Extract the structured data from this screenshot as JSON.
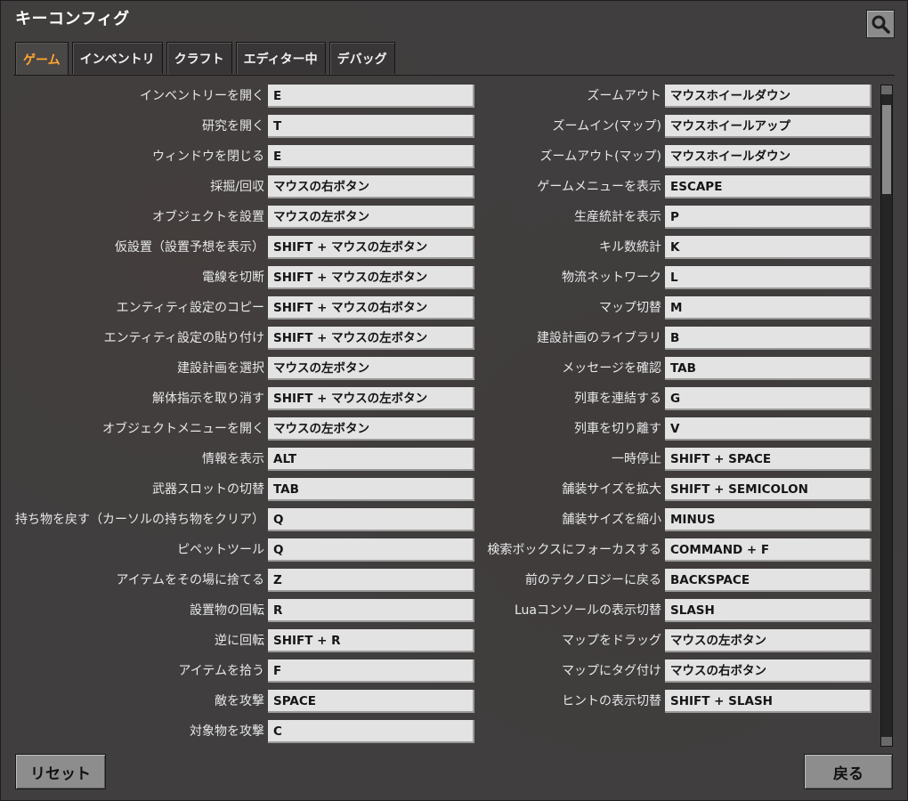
{
  "window": {
    "title": "キーコンフィグ"
  },
  "tabs": [
    {
      "label": "ゲーム",
      "active": true
    },
    {
      "label": "インベントリ",
      "active": false
    },
    {
      "label": "クラフト",
      "active": false
    },
    {
      "label": "エディター中",
      "active": false
    },
    {
      "label": "デバッグ",
      "active": false
    }
  ],
  "left_bindings": [
    {
      "action": "インベントリーを開く",
      "key": "E"
    },
    {
      "action": "研究を開く",
      "key": "T"
    },
    {
      "action": "ウィンドウを閉じる",
      "key": "E"
    },
    {
      "action": "採掘/回収",
      "key": "マウスの右ボタン"
    },
    {
      "action": "オブジェクトを設置",
      "key": "マウスの左ボタン"
    },
    {
      "action": "仮設置（設置予想を表示）",
      "key": "SHIFT + マウスの左ボタン"
    },
    {
      "action": "電線を切断",
      "key": "SHIFT + マウスの左ボタン"
    },
    {
      "action": "エンティティ設定のコピー",
      "key": "SHIFT + マウスの右ボタン"
    },
    {
      "action": "エンティティ設定の貼り付け",
      "key": "SHIFT + マウスの左ボタン"
    },
    {
      "action": "建設計画を選択",
      "key": "マウスの左ボタン"
    },
    {
      "action": "解体指示を取り消す",
      "key": "SHIFT + マウスの左ボタン"
    },
    {
      "action": "オブジェクトメニューを開く",
      "key": "マウスの左ボタン"
    },
    {
      "action": "情報を表示",
      "key": "ALT"
    },
    {
      "action": "武器スロットの切替",
      "key": "TAB"
    },
    {
      "action": "持ち物を戻す（カーソルの持ち物をクリア）",
      "key": "Q"
    },
    {
      "action": "ピペットツール",
      "key": "Q"
    },
    {
      "action": "アイテムをその場に捨てる",
      "key": "Z"
    },
    {
      "action": "設置物の回転",
      "key": "R"
    },
    {
      "action": "逆に回転",
      "key": "SHIFT + R"
    },
    {
      "action": "アイテムを拾う",
      "key": "F"
    },
    {
      "action": "敵を攻撃",
      "key": "SPACE"
    },
    {
      "action": "対象物を攻撃",
      "key": "C"
    }
  ],
  "right_bindings": [
    {
      "action": "ズームアウト",
      "key": "マウスホイールダウン"
    },
    {
      "action": "ズームイン(マップ)",
      "key": "マウスホイールアップ"
    },
    {
      "action": "ズームアウト(マップ)",
      "key": "マウスホイールダウン"
    },
    {
      "action": "ゲームメニューを表示",
      "key": "ESCAPE"
    },
    {
      "action": "生産統計を表示",
      "key": "P"
    },
    {
      "action": "キル数統計",
      "key": "K"
    },
    {
      "action": "物流ネットワーク",
      "key": "L"
    },
    {
      "action": "マップ切替",
      "key": "M"
    },
    {
      "action": "建設計画のライブラリ",
      "key": "B"
    },
    {
      "action": "メッセージを確認",
      "key": "TAB"
    },
    {
      "action": "列車を連結する",
      "key": "G"
    },
    {
      "action": "列車を切り離す",
      "key": "V"
    },
    {
      "action": "一時停止",
      "key": "SHIFT + SPACE"
    },
    {
      "action": "舗装サイズを拡大",
      "key": "SHIFT + SEMICOLON"
    },
    {
      "action": "舗装サイズを縮小",
      "key": "MINUS"
    },
    {
      "action": "検索ボックスにフォーカスする",
      "key": "COMMAND + F"
    },
    {
      "action": "前のテクノロジーに戻る",
      "key": "BACKSPACE"
    },
    {
      "action": "Luaコンソールの表示切替",
      "key": "SLASH"
    },
    {
      "action": "マップをドラッグ",
      "key": "マウスの左ボタン"
    },
    {
      "action": "マップにタグ付け",
      "key": "マウスの右ボタン"
    },
    {
      "action": "ヒントの表示切替",
      "key": "SHIFT + SLASH"
    }
  ],
  "buttons": {
    "reset": "リセット",
    "back": "戻る"
  }
}
